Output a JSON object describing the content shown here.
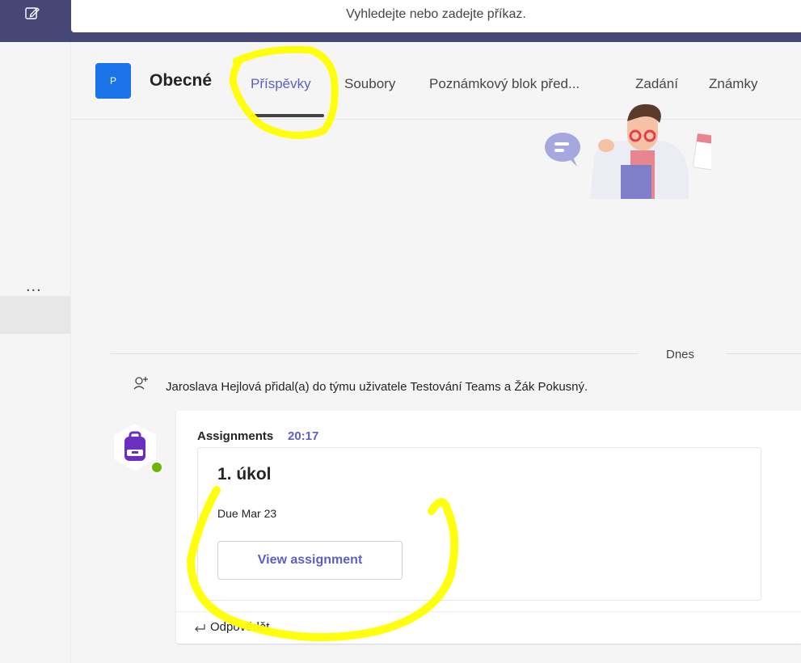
{
  "search": {
    "placeholder": "Vyhledejte nebo zadejte příkaz."
  },
  "rail": {
    "more_label": "..."
  },
  "header": {
    "team_initial": "P",
    "channel_name": "Obecné",
    "tabs": [
      {
        "label": "Příspěvky",
        "active": true
      },
      {
        "label": "Soubory"
      },
      {
        "label": "Poznámkový blok před..."
      },
      {
        "label": "Zadání"
      },
      {
        "label": "Známky"
      }
    ]
  },
  "feed": {
    "date_separator": "Dnes",
    "activity": "Jaroslava Hejlová přidal(a) do týmu uživatele Testování Teams a Žák Pokusný.",
    "message": {
      "author": "Assignments",
      "time": "20:17",
      "card": {
        "title": "1. úkol",
        "due": "Due Mar 23",
        "button_label": "View assignment"
      },
      "reply_label": "Odpovědět"
    }
  },
  "colors": {
    "accent": "#5b5fc7",
    "topbar": "#464775",
    "highlight": "#ffff00",
    "presence": "#6bb700"
  }
}
